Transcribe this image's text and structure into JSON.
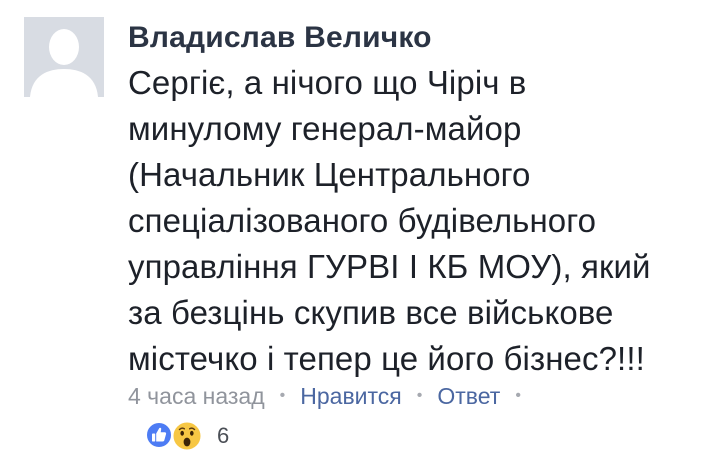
{
  "comment": {
    "author": "Владислав Величко",
    "text_lines": [
      "Сергіє, а нічого що Чіріч в",
      "минулому генерал-майор",
      "(Начальник Центрального",
      "спеціалізованого будівельного",
      "управління ГУРВІ І КБ МОУ), який",
      "за безцінь скупив все військове",
      "містечко і тепер це його бізнес?!!!"
    ],
    "timestamp": "4 часа назад",
    "separator": "•",
    "like_label": "Нравится",
    "reply_label": "Ответ",
    "reactions": {
      "icons": [
        "like-icon",
        "wow-icon"
      ],
      "count": "6"
    }
  },
  "colors": {
    "author": "#2b3444",
    "text": "#1d2129",
    "meta": "#90949c",
    "link": "#4b67a1",
    "like_blue": "#4d7cf4",
    "wow_yellow": "#f7c744"
  }
}
